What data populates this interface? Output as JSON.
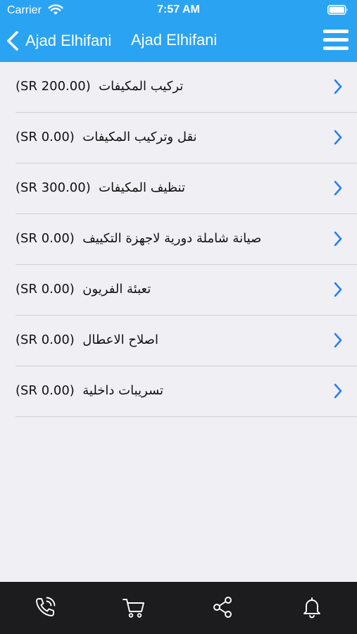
{
  "status_bar": {
    "carrier": "Carrier",
    "time": "7:57 AM"
  },
  "nav": {
    "back_label": "Ajad Elhifani",
    "title": "Ajad Elhifani"
  },
  "services": [
    {
      "name": "تركيب المكيفات",
      "price": "(200.00 SR)"
    },
    {
      "name": "نقل وتركيب المكيفات",
      "price": "(0.00 SR)"
    },
    {
      "name": "تنظيف المكيفات",
      "price": "(300.00 SR)"
    },
    {
      "name": "صيانة شاملة دورية لاجهزة التكييف",
      "price": "(0.00 SR)"
    },
    {
      "name": "تعبئة الفريون",
      "price": "(0.00 SR)"
    },
    {
      "name": "اصلاح الاعطال",
      "price": "(0.00 SR)"
    },
    {
      "name": "تسريبات داخلية",
      "price": "(0.00 SR)"
    }
  ],
  "tab_bar": {
    "items": [
      "phone-icon",
      "cart-icon",
      "share-icon",
      "bell-icon"
    ]
  },
  "colors": {
    "header": "#2aa3f2",
    "accent": "#2a7ff0",
    "tab_bar": "#1c1c1e",
    "background": "#efeff4"
  }
}
